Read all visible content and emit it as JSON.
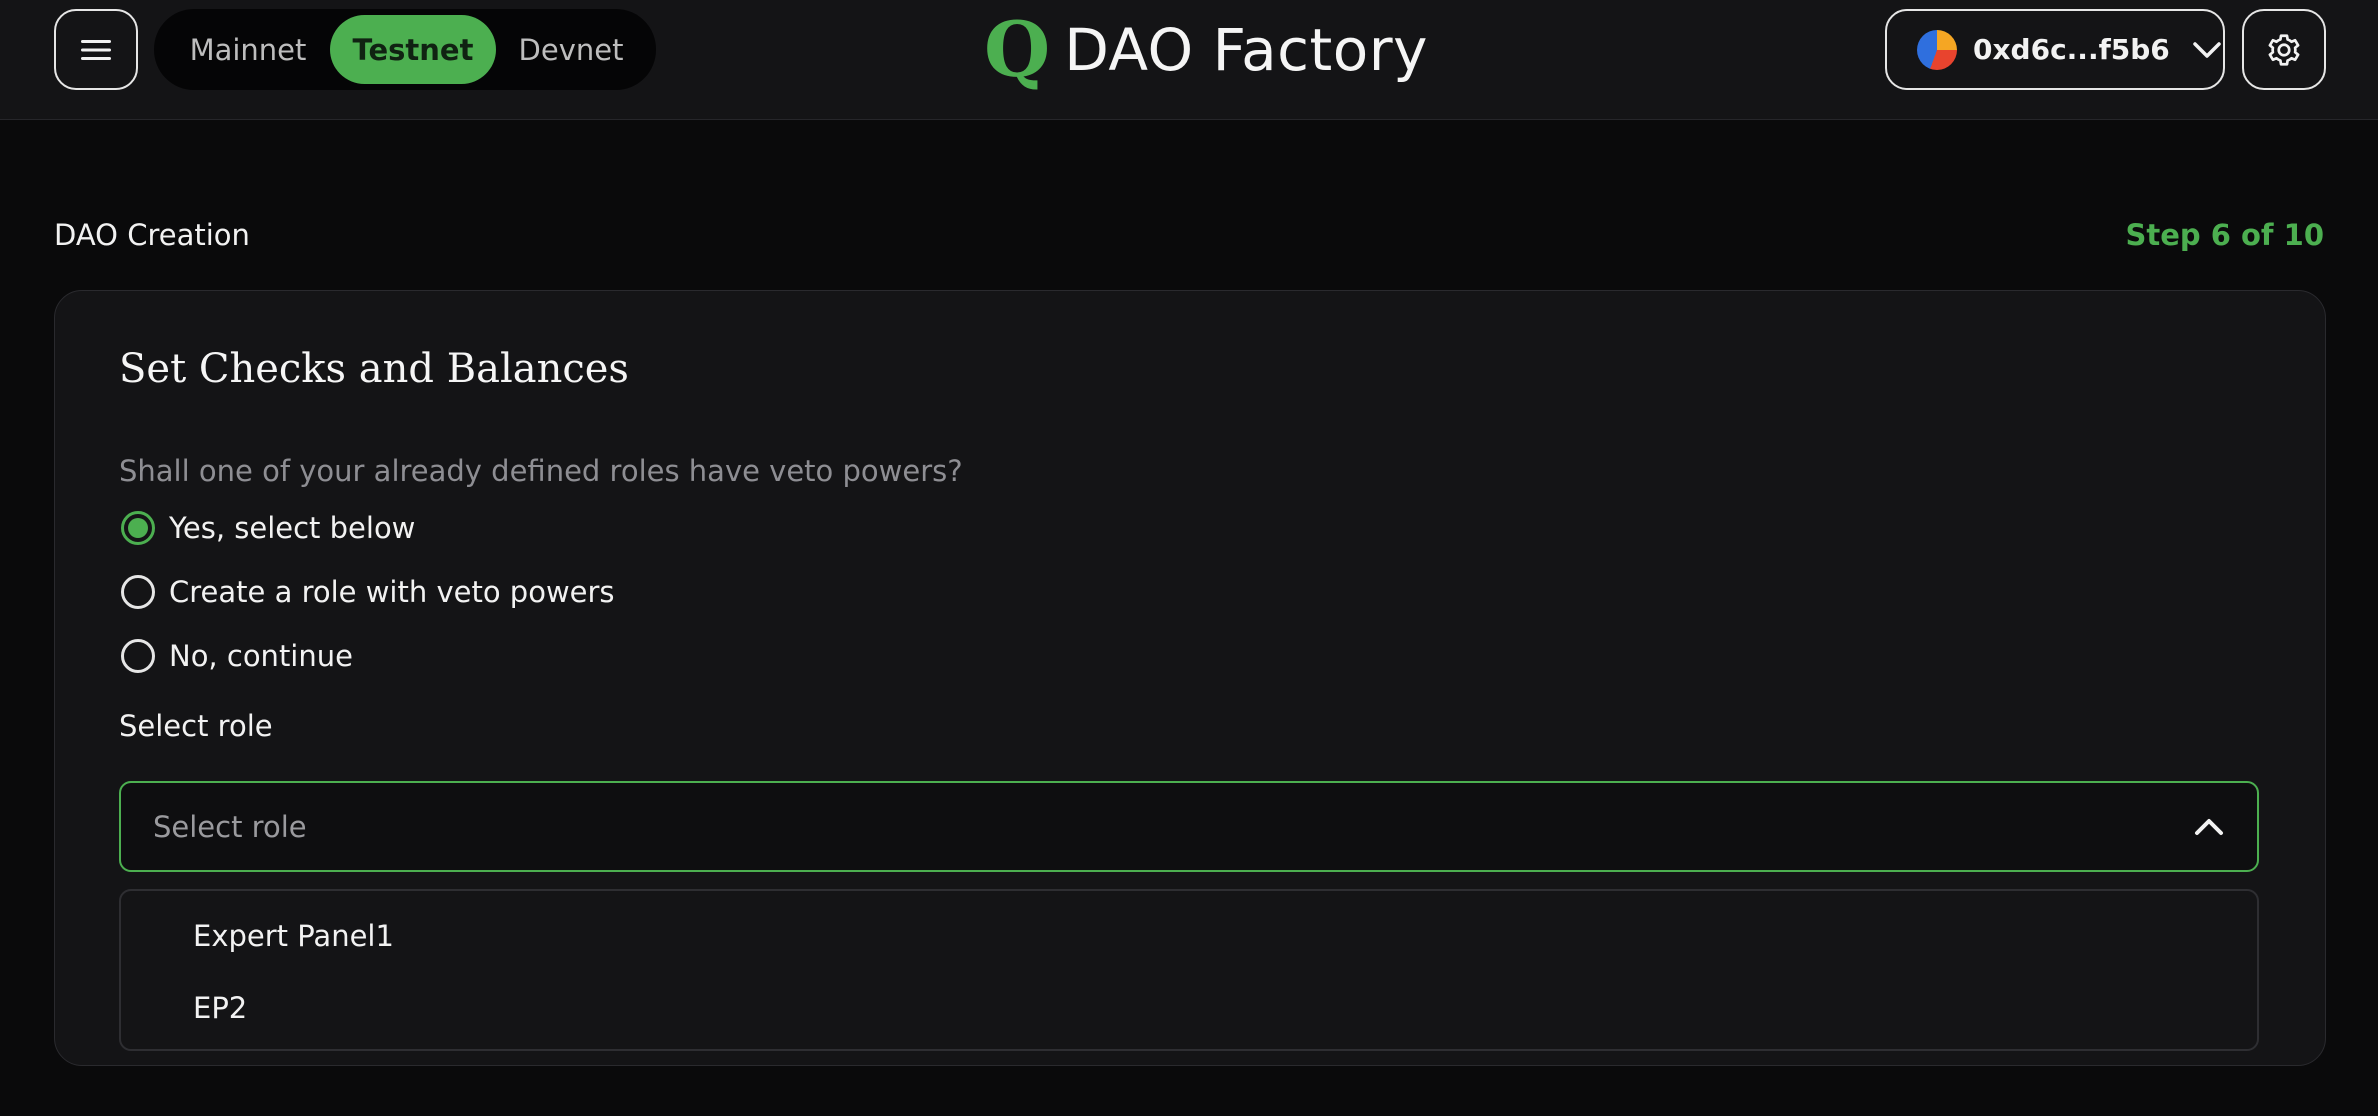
{
  "header": {
    "networks": [
      {
        "label": "Mainnet",
        "active": false
      },
      {
        "label": "Testnet",
        "active": true
      },
      {
        "label": "Devnet",
        "active": false
      }
    ],
    "logo_mark": "Q",
    "app_title": "DAO Factory",
    "wallet_address": "0xd6c...f5b6",
    "icons": {
      "menu": "hamburger-menu-icon",
      "wallet_dropdown": "chevron-down-icon",
      "settings": "gear-icon"
    }
  },
  "page": {
    "section_label": "DAO Creation",
    "step_indicator": "Step 6 of 10"
  },
  "card": {
    "title": "Set Checks and Balances",
    "question": "Shall one of your already defined roles have veto powers?",
    "options": [
      {
        "label": "Yes, select below",
        "checked": true
      },
      {
        "label": "Create a role with veto powers",
        "checked": false
      },
      {
        "label": "No, continue",
        "checked": false
      }
    ],
    "select": {
      "label": "Select role",
      "placeholder": "Select role",
      "expanded": true,
      "options": [
        "Expert Panel1",
        "EP2"
      ]
    }
  },
  "colors": {
    "accent": "#4caf50",
    "background": "#0a0a0b",
    "surface": "#141416",
    "muted_text": "#8e8e93"
  }
}
